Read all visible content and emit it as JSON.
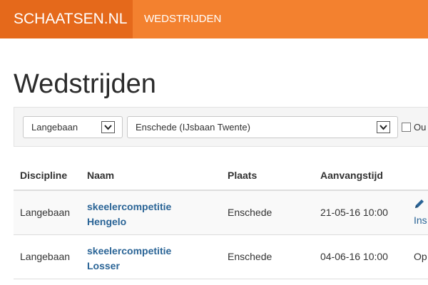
{
  "navbar": {
    "brand": "SCHAATSEN.NL",
    "link": "WEDSTRIJDEN"
  },
  "page": {
    "title": "Wedstrijden"
  },
  "filters": {
    "discipline": "Langebaan",
    "location": "Enschede (IJsbaan Twente)",
    "checkbox_label": "Ou",
    "checkbox_checked": false
  },
  "table": {
    "headers": [
      "Discipline",
      "Naam",
      "Plaats",
      "Aanvangstijd"
    ],
    "rows": [
      {
        "discipline": "Langebaan",
        "name_line1": "skeelercompetitie",
        "name_line2": "Hengelo",
        "place": "Enschede",
        "start": "21-05-16 10:00",
        "action": "Ins",
        "action_icon": "pencil-icon"
      },
      {
        "discipline": "Langebaan",
        "name_line1": "skeelercompetitie",
        "name_line2": "Losser",
        "place": "Enschede",
        "start": "04-06-16 10:00",
        "status": "Op"
      }
    ]
  },
  "colors": {
    "navbar": "#f3812f",
    "brand": "#e5691b",
    "link": "#2a6496"
  }
}
